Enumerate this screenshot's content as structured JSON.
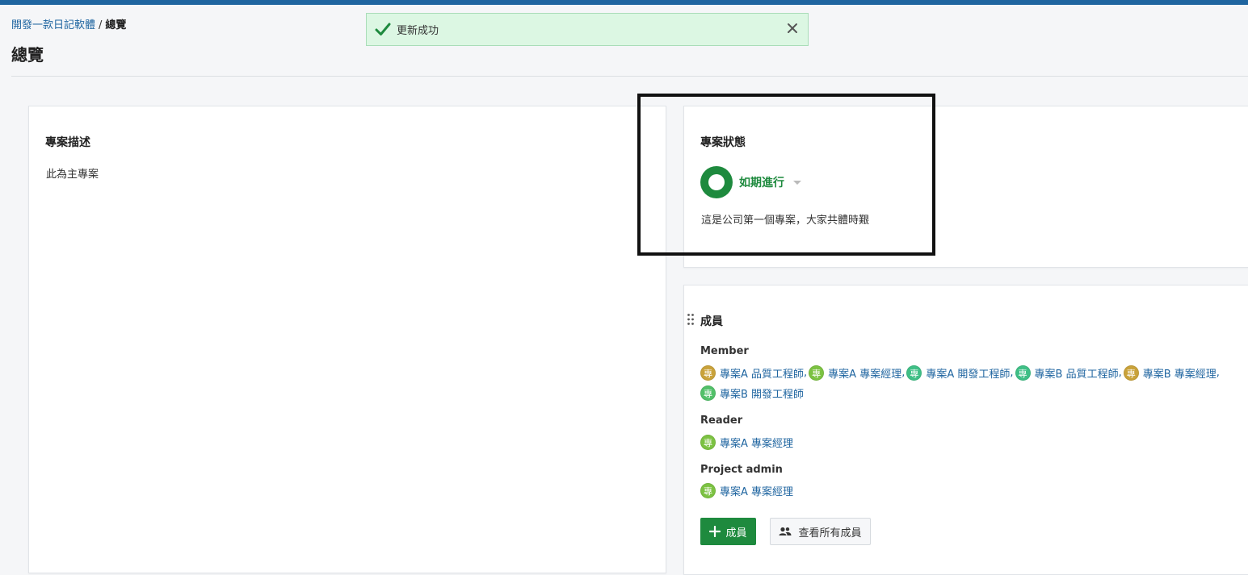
{
  "breadcrumb": {
    "project": "開發一款日記軟體",
    "separator": "/",
    "current": "總覽"
  },
  "page_title": "總覽",
  "toast": {
    "message": "更新成功",
    "color": "#dcf7e3"
  },
  "description_card": {
    "title": "專案描述",
    "body": "此為主專案"
  },
  "status_card": {
    "title": "專案狀態",
    "status_label": "如期進行",
    "status_color": "#1e8a3e",
    "note": "這是公司第一個專案，大家共體時艱"
  },
  "members_card": {
    "title": "成員",
    "roles": [
      {
        "name": "Member",
        "members": [
          {
            "avatar_text": "專",
            "avatar_color": "#c9a23a",
            "name": "專案A 品質工程師"
          },
          {
            "avatar_text": "專",
            "avatar_color": "#7cc242",
            "name": "專案A 專案經理"
          },
          {
            "avatar_text": "專",
            "avatar_color": "#3fbf86",
            "name": "專案A 開發工程師"
          },
          {
            "avatar_text": "專",
            "avatar_color": "#3fbf86",
            "name": "專案B 品質工程師"
          },
          {
            "avatar_text": "專",
            "avatar_color": "#c9a23a",
            "name": "專案B 專案經理"
          },
          {
            "avatar_text": "專",
            "avatar_color": "#52c069",
            "name": "專案B 開發工程師"
          }
        ]
      },
      {
        "name": "Reader",
        "members": [
          {
            "avatar_text": "專",
            "avatar_color": "#7cc242",
            "name": "專案A 專案經理"
          }
        ]
      },
      {
        "name": "Project admin",
        "members": [
          {
            "avatar_text": "專",
            "avatar_color": "#7cc242",
            "name": "專案A 專案經理"
          }
        ]
      }
    ],
    "add_button": "成員",
    "view_all_button": "查看所有成員"
  },
  "colors": {
    "accent": "#1f65a0",
    "success": "#1e8a3e"
  }
}
